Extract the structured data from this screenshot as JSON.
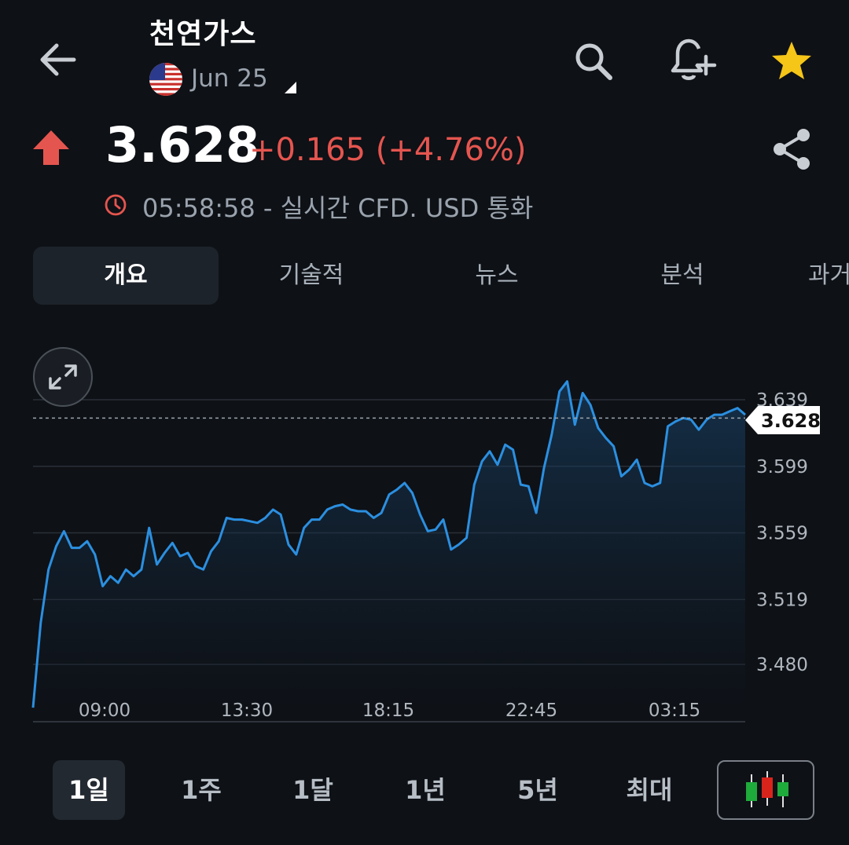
{
  "header": {
    "title": "천연가스",
    "exchange": "Jun 25",
    "icons": {
      "back": "back-arrow-icon",
      "search": "search-icon",
      "alert": "add-alert-bell-icon",
      "favorite": "star-icon"
    }
  },
  "quote": {
    "price": "3.628",
    "change": "+0.165 (+4.76%)",
    "status": "05:58:58 - 실시간 CFD. USD 통화",
    "trend": "up",
    "colors": {
      "up": "#e5554f",
      "accent_star": "#f5c518",
      "line": "#2b8fe0"
    }
  },
  "tabs": [
    {
      "label": "개요",
      "active": true
    },
    {
      "label": "기술적",
      "active": false
    },
    {
      "label": "뉴스",
      "active": false
    },
    {
      "label": "분석",
      "active": false
    },
    {
      "label": "과거",
      "active": false
    }
  ],
  "chart_data": {
    "type": "area",
    "x_ticks": [
      "09:00",
      "13:30",
      "18:15",
      "22:45",
      "03:15"
    ],
    "y_ticks": [
      "3.639",
      "3.599",
      "3.559",
      "3.519",
      "3.480"
    ],
    "ylim": [
      3.454,
      3.659
    ],
    "current_price_label": "3.628",
    "current_price": 3.628,
    "grid": true,
    "values": [
      3.454,
      3.505,
      3.537,
      3.551,
      3.56,
      3.55,
      3.55,
      3.554,
      3.546,
      3.527,
      3.533,
      3.529,
      3.537,
      3.533,
      3.537,
      3.562,
      3.54,
      3.547,
      3.553,
      3.545,
      3.547,
      3.539,
      3.537,
      3.548,
      3.554,
      3.568,
      3.567,
      3.567,
      3.566,
      3.565,
      3.568,
      3.573,
      3.57,
      3.552,
      3.546,
      3.562,
      3.567,
      3.567,
      3.573,
      3.575,
      3.576,
      3.573,
      3.572,
      3.572,
      3.568,
      3.571,
      3.582,
      3.585,
      3.589,
      3.583,
      3.57,
      3.56,
      3.561,
      3.567,
      3.549,
      3.552,
      3.556,
      3.588,
      3.602,
      3.608,
      3.6,
      3.612,
      3.609,
      3.588,
      3.587,
      3.571,
      3.598,
      3.618,
      3.644,
      3.65,
      3.624,
      3.643,
      3.636,
      3.622,
      3.616,
      3.611,
      3.593,
      3.597,
      3.603,
      3.589,
      3.587,
      3.589,
      3.623,
      3.626,
      3.628,
      3.627,
      3.621,
      3.627,
      3.63,
      3.63,
      3.632,
      3.634,
      3.63
    ],
    "color": "#2b8fe0"
  },
  "range_bar": {
    "ranges": [
      {
        "label": "1일",
        "active": true
      },
      {
        "label": "1주",
        "active": false
      },
      {
        "label": "1달",
        "active": false
      },
      {
        "label": "1년",
        "active": false
      },
      {
        "label": "5년",
        "active": false
      },
      {
        "label": "최대",
        "active": false
      }
    ],
    "chart_type_icon": "candlestick-icon"
  }
}
